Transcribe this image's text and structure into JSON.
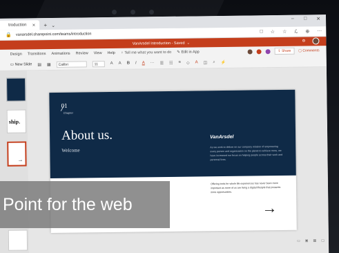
{
  "browser": {
    "tab_title": "troduction",
    "tab_close": "✕",
    "new_tab": "+",
    "tab_menu": "⌄",
    "window_controls": [
      "–",
      "□",
      "✕"
    ],
    "url": "vanarsdel.sharepoint.com/teams/introduction",
    "address_icons": [
      "□",
      "☆",
      "☆",
      "ℒ",
      "⊕",
      "···"
    ]
  },
  "ppt": {
    "title": "VanArsdel Introduction - Saved",
    "title_suffix": "⌄",
    "menus": [
      "Design",
      "Transitions",
      "Animations",
      "Review",
      "View",
      "Help"
    ],
    "tell_me": "Tell me what you want to do",
    "edit_in_app": "Edit in App",
    "share": "Share",
    "comments": "Comments",
    "new_slide": "New Slide",
    "font": "Calibri",
    "font_size": "11",
    "ribbon_glyphs": [
      "A",
      "A",
      "B",
      "I",
      "A",
      "···"
    ]
  },
  "thumbnails": {
    "thumb2_text": "ship."
  },
  "slide": {
    "number": "01",
    "chapter": "Chapter",
    "heading": "About us.",
    "subheading": "Welcome",
    "brand": "VanArsdel",
    "blurb": "As we work to deliver on our company mission of empowering every person and organization on the planet to achieve more, we have increased our focus on helping people across their work and personal lives.",
    "blurb2": "Offering tools for whole life experiences has never been more important as more of us are living a digital lifestyle that presents more opportunities.",
    "arrow": "→"
  },
  "caption": {
    "text": "Point for the web"
  },
  "colors": {
    "ppt_accent": "#c43e1c",
    "slide_navy": "#0f2a47"
  }
}
